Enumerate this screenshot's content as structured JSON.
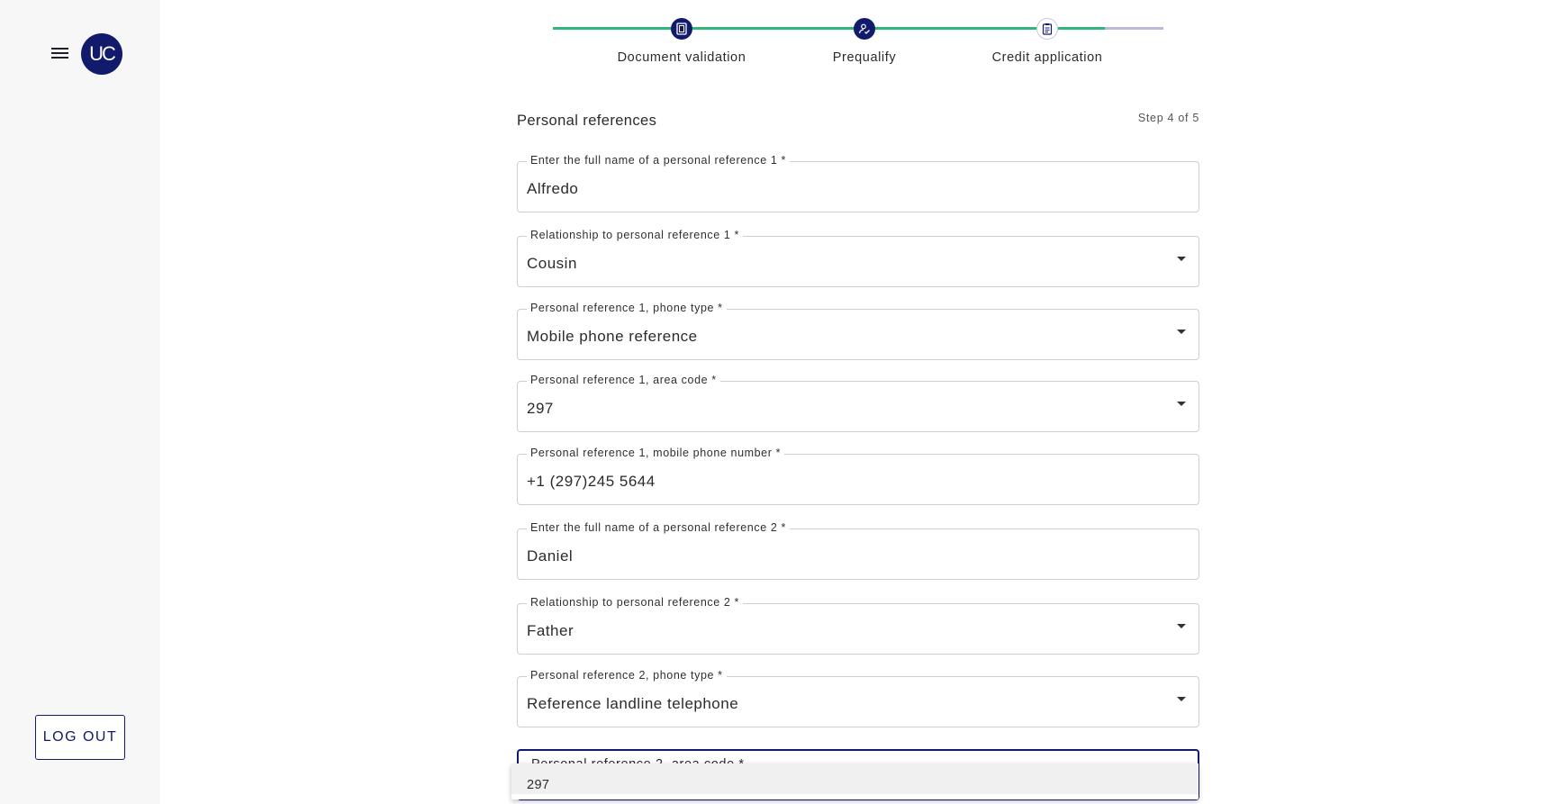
{
  "sidebar": {
    "avatar_initials": "UC",
    "logout_label": "LOG OUT"
  },
  "stepper": {
    "steps": [
      {
        "label": "Document validation",
        "status": "completed"
      },
      {
        "label": "Prequalify",
        "status": "completed"
      },
      {
        "label": "Credit application",
        "status": "active"
      }
    ],
    "colors": {
      "completed": "#2db87a",
      "pending": "#b9bad8",
      "icon": "#121a6b"
    }
  },
  "form": {
    "section_title": "Personal references",
    "step_indicator": "Step 4 of 5",
    "fields": [
      {
        "label": "Enter the full name of a personal reference 1 *",
        "value": "Alfredo",
        "type": "text"
      },
      {
        "label": "Relationship to personal reference 1 *",
        "value": "Cousin",
        "type": "select"
      },
      {
        "label": "Personal reference 1, phone type *",
        "value": "Mobile phone reference",
        "type": "select"
      },
      {
        "label": "Personal reference 1, area code *",
        "value": "297",
        "type": "select"
      },
      {
        "label": "Personal reference 1, mobile phone number *",
        "value": "+1 (297)245 5644",
        "type": "text"
      },
      {
        "label": "Enter the full name of a personal reference 2 *",
        "value": "Daniel",
        "type": "text"
      },
      {
        "label": "Relationship to personal reference 2 *",
        "value": "Father",
        "type": "select"
      },
      {
        "label": "Personal reference 2, phone type *",
        "value": "Reference landline telephone",
        "type": "select"
      },
      {
        "label": "Personal reference 2, area code *",
        "value": "",
        "type": "select",
        "focused": true
      }
    ],
    "dropdown_options": [
      "297"
    ]
  },
  "accent_color": "#121a6b"
}
